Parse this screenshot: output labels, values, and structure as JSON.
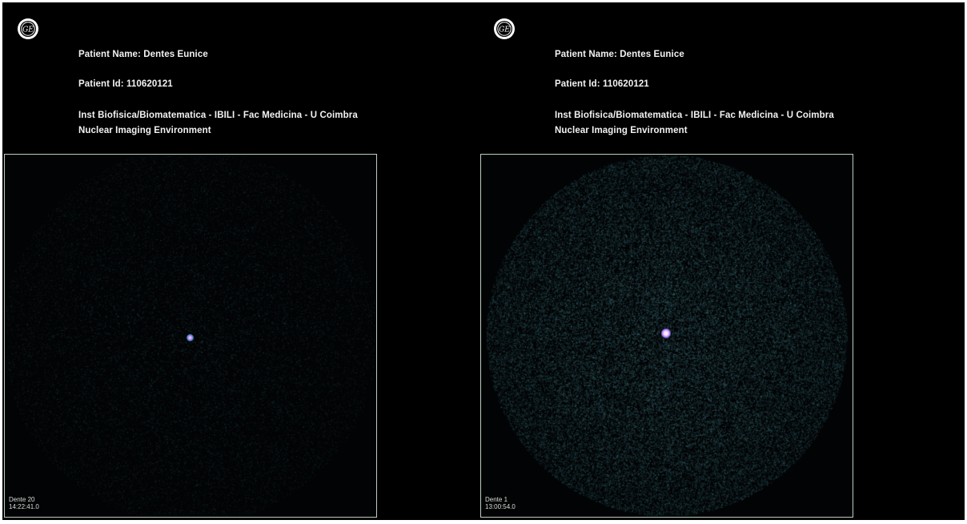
{
  "panels": [
    {
      "logo": "ge-logo-icon",
      "patient_name": "Patient Name: Dentes Eunice",
      "patient_id": "Patient Id: 110620121",
      "institution": "Inst Biofisica/Biomatematica - IBILI - Fac Medicina - U Coimbra",
      "environment": "Nuclear Imaging Environment",
      "image": {
        "series_label": "Dente 20",
        "timestamp": "14:22:41.0"
      }
    },
    {
      "logo": "ge-logo-icon",
      "patient_name": "Patient Name: Dentes Eunice",
      "patient_id": "Patient Id: 110620121",
      "institution": "Inst Biofisica/Biomatematica - IBILI - Fac Medicina - U Coimbra",
      "environment": "Nuclear Imaging Environment",
      "image": {
        "series_label": "Dente 1",
        "timestamp": "13:00:54.0"
      }
    }
  ],
  "colors": {
    "background": "#000000",
    "frame_border": "#b9cfc2",
    "header_text": "#f2f2f2"
  }
}
